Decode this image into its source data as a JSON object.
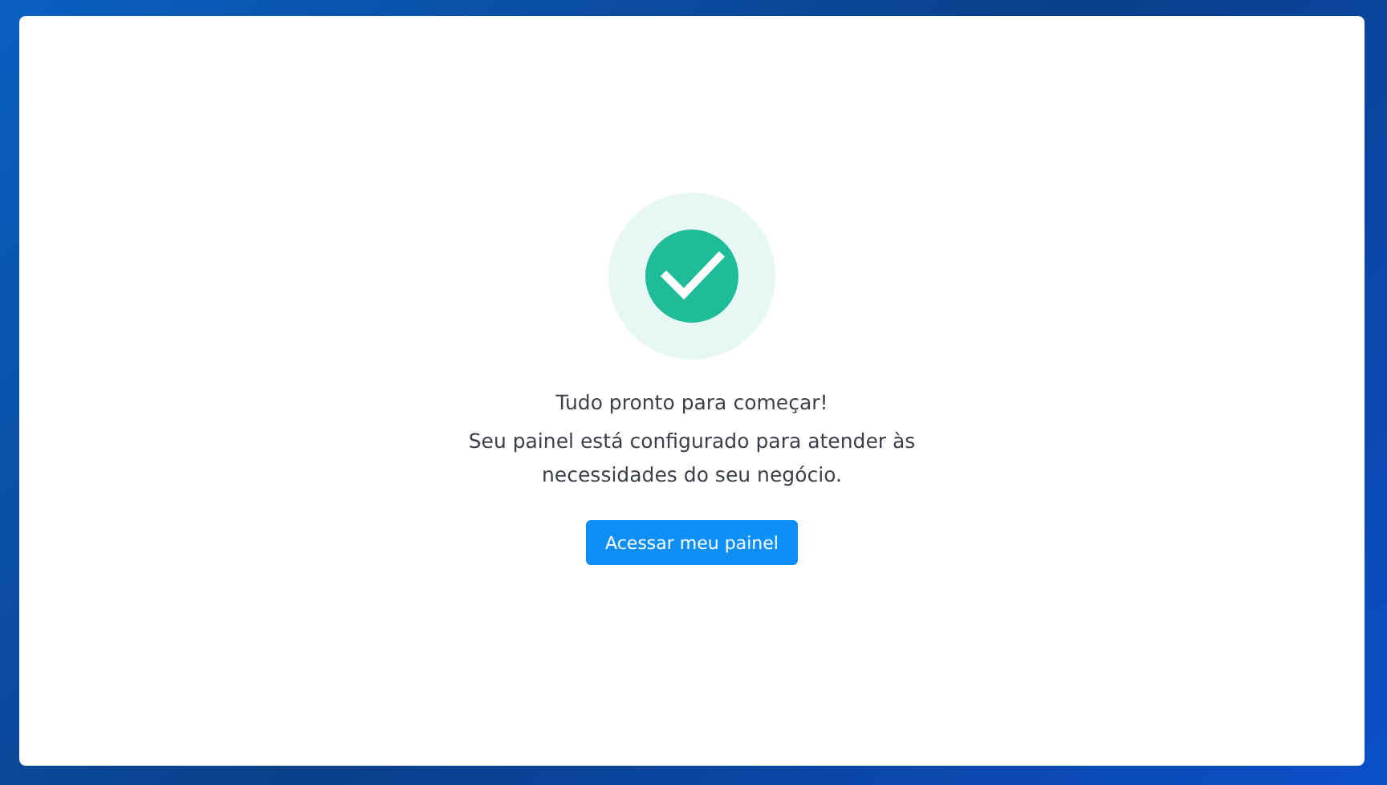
{
  "success": {
    "title": "Tudo pronto para começar!",
    "message": "Seu painel está configurado para atender às necessidades do seu negócio.",
    "button": "Acessar meu painel"
  }
}
